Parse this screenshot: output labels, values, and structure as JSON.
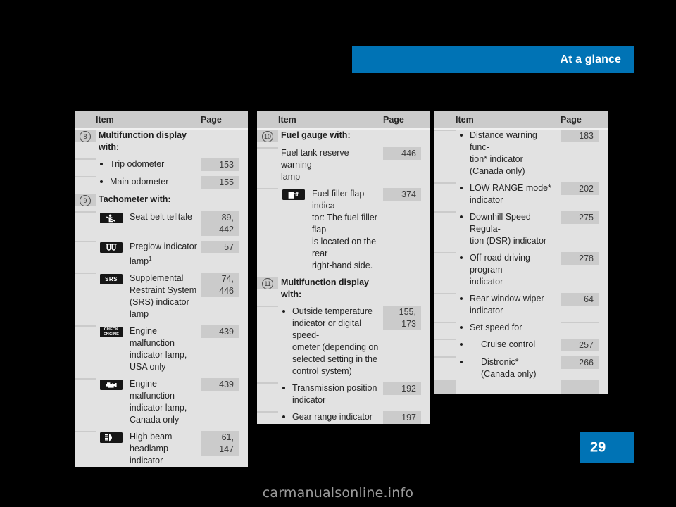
{
  "header": {
    "title": "At a glance",
    "bar_color": "#0073b5"
  },
  "footer": {
    "page_number": "29",
    "badge_color": "#0073b5",
    "watermark": "carmanualsonline.info"
  },
  "columns": [
    {
      "id": "column-1",
      "header": {
        "item": "Item",
        "page": "Page"
      },
      "rows": [
        {
          "num": "8",
          "kind": "head",
          "text": "Multifunction display with:",
          "page": ""
        },
        {
          "num": "",
          "kind": "b1",
          "text": "Trip odometer",
          "page": "153"
        },
        {
          "num": "",
          "kind": "b1",
          "text": "Main odometer",
          "page": "155"
        },
        {
          "num": "9",
          "kind": "head",
          "text": "Tachometer with:",
          "page": ""
        },
        {
          "num": "",
          "kind": "icon",
          "icon": "seat-belt-telltale-icon",
          "text": "Seat belt telltale",
          "page": "89,\n442"
        },
        {
          "num": "",
          "kind": "icon",
          "icon": "preglow-indicator-icon",
          "text": "Preglow indicator\nlamp",
          "sup": "1",
          "page": "57"
        },
        {
          "num": "",
          "kind": "icon",
          "icon": "srs-icon",
          "text": "Supplemental\nRestraint System\n(SRS) indicator lamp",
          "page": "74,\n446"
        },
        {
          "num": "",
          "kind": "icon",
          "icon": "check-engine-icon",
          "text": "Engine malfunction\nindicator lamp,\nUSA only",
          "page": "439"
        },
        {
          "num": "",
          "kind": "icon",
          "icon": "engine-malfunction-icon",
          "text": "Engine malfunction\nindicator lamp,\nCanada only",
          "page": "439"
        },
        {
          "num": "",
          "kind": "icon",
          "icon": "high-beam-icon",
          "text": "High beam headlamp\nindicator",
          "page": "61,\n147"
        }
      ]
    },
    {
      "id": "column-2",
      "header": {
        "item": "Item",
        "page": "Page"
      },
      "rows": [
        {
          "num": "10",
          "kind": "head",
          "text": "Fuel gauge with:",
          "page": ""
        },
        {
          "num": "",
          "kind": "plain",
          "text": "Fuel tank reserve warning\nlamp",
          "page": "446"
        },
        {
          "num": "",
          "kind": "icon",
          "icon": "fuel-filler-flap-icon",
          "text": "Fuel filler flap indica-\ntor: The fuel filler flap\nis located on the rear\nright-hand side.",
          "page": "374"
        },
        {
          "num": "11",
          "kind": "head",
          "text": "Multifunction display\nwith:",
          "page": ""
        },
        {
          "num": "",
          "kind": "b1",
          "text": "Outside temperature\nindicator or digital speed-\nometer (depending on\nselected setting in the\ncontrol system)",
          "page": "155,\n173"
        },
        {
          "num": "",
          "kind": "b1",
          "text": "Transmission position\nindicator",
          "page": "192"
        },
        {
          "num": "",
          "kind": "b1",
          "text": "Gear range indicator",
          "page": "197"
        }
      ]
    },
    {
      "id": "column-3",
      "header": {
        "item": "Item",
        "page": "Page"
      },
      "rows": [
        {
          "num": "",
          "kind": "b1",
          "text": "Distance warning func-\ntion* indicator\n(Canada only)",
          "page": "183"
        },
        {
          "num": "",
          "kind": "b1",
          "text": "LOW RANGE mode*\nindicator",
          "page": "202"
        },
        {
          "num": "",
          "kind": "b1",
          "text": "Downhill Speed Regula-\ntion (DSR) indicator",
          "page": "275"
        },
        {
          "num": "",
          "kind": "b1",
          "text": "Off-road driving program\nindicator",
          "page": "278"
        },
        {
          "num": "",
          "kind": "b1",
          "text": "Rear window wiper\nindicator",
          "page": "64"
        },
        {
          "num": "",
          "kind": "b1",
          "text": "Set speed for",
          "page": ""
        },
        {
          "num": "",
          "kind": "b2",
          "text": "Cruise control",
          "page": "257"
        },
        {
          "num": "",
          "kind": "b2",
          "text": "Distronic*\n(Canada only)",
          "page": "266"
        }
      ]
    }
  ]
}
